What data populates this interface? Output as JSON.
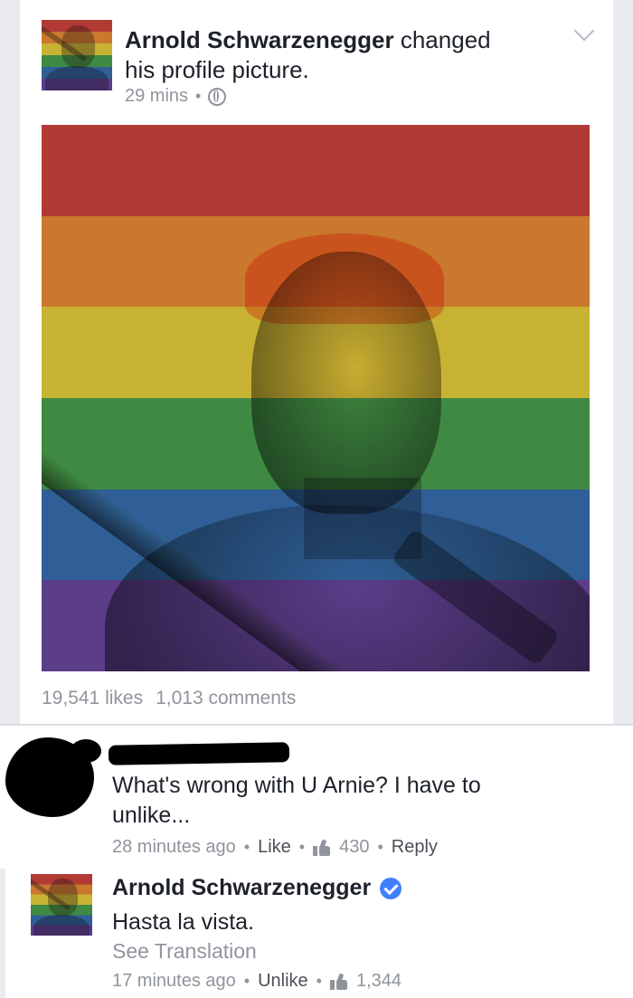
{
  "post": {
    "author": "Arnold Schwarzenegger",
    "action_text": " changed his profile picture.",
    "time": "29 mins",
    "privacy_icon": "globe-icon",
    "photo_flag_colors": [
      "#b23a35",
      "#c9782d",
      "#c8b234",
      "#3f8a43",
      "#2f5f96",
      "#5b3d8a"
    ],
    "likes": "19,541 likes",
    "comments": "1,013 comments"
  },
  "comments": [
    {
      "author": "",
      "text": "What's wrong with U Arnie? I have to unlike...",
      "time": "28 minutes ago",
      "action_label": "Like",
      "reaction_count": "430",
      "reply_label": "Reply"
    }
  ],
  "reply": {
    "author": "Arnold Schwarzenegger",
    "verified": true,
    "text": "Hasta la vista.",
    "see_translation": "See Translation",
    "time": "17 minutes ago",
    "action_label": "Unlike",
    "reaction_count": "1,344"
  },
  "colors": {
    "text_primary": "#1d2129",
    "text_secondary": "#90949c",
    "verified_blue": "#4080ff"
  }
}
